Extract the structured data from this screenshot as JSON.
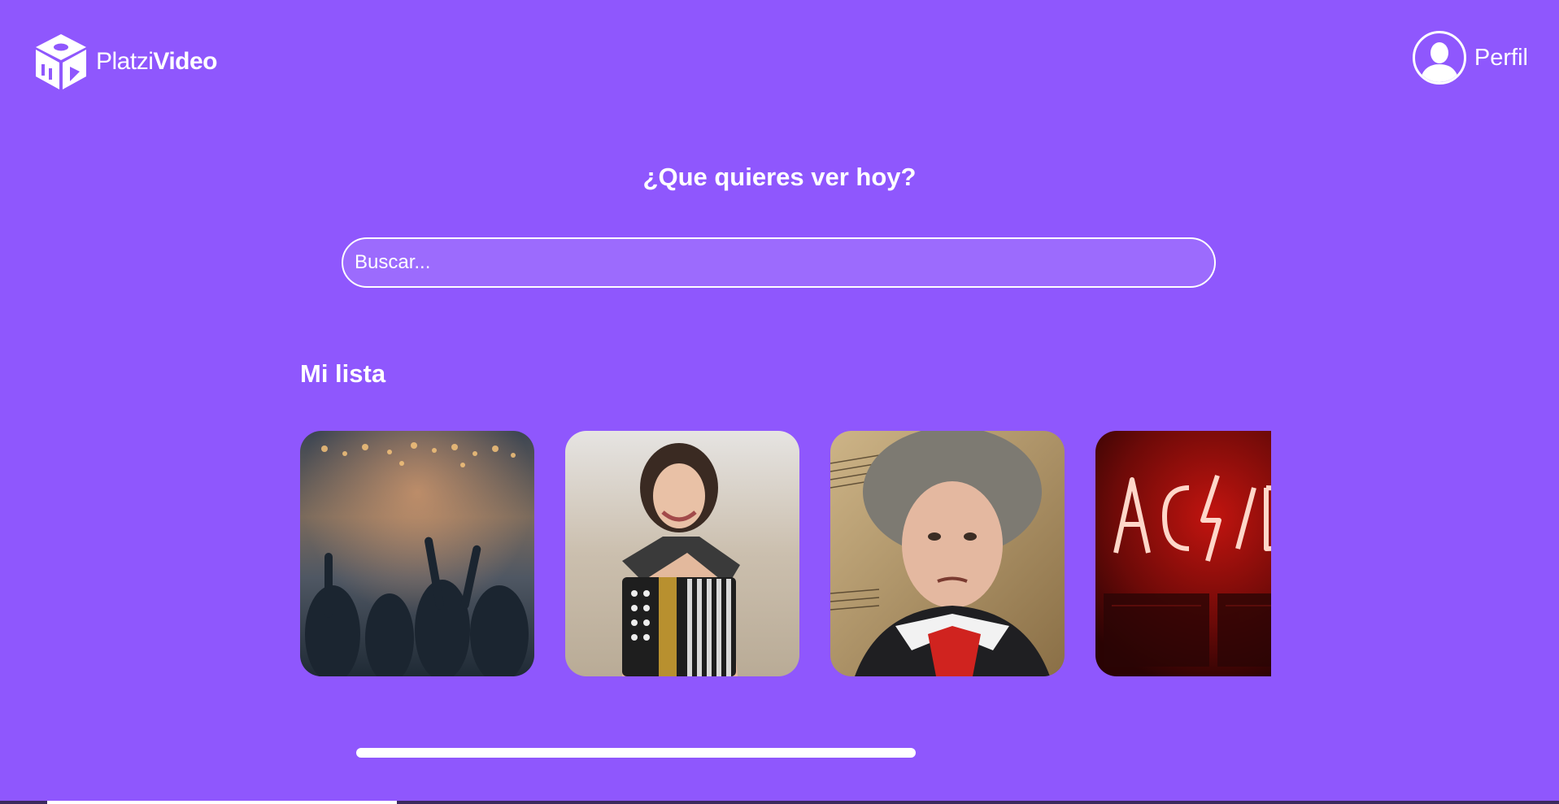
{
  "header": {
    "logo": {
      "icon": "cube-logo-icon",
      "text_light": "Platzi",
      "text_bold": "Video"
    },
    "profile": {
      "icon": "user-avatar-icon",
      "label": "Perfil"
    }
  },
  "main": {
    "title": "¿Que quieres ver hoy?",
    "search": {
      "placeholder": "Buscar...",
      "value": ""
    }
  },
  "list": {
    "title": "Mi lista",
    "items": [
      {
        "thumbnail": "concert-crowd-image"
      },
      {
        "thumbnail": "accordion-player-image"
      },
      {
        "thumbnail": "beethoven-portrait-image"
      },
      {
        "thumbnail": "acdc-neon-image"
      }
    ],
    "scroll_position": 0
  },
  "colors": {
    "background": "#8f57fd",
    "text": "#ffffff"
  }
}
